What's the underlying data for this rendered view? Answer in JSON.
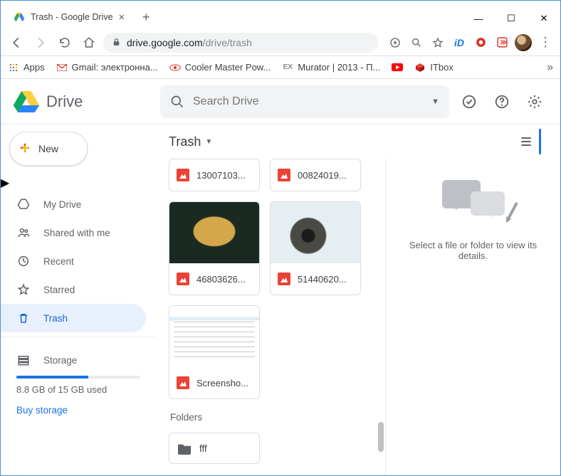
{
  "window": {
    "tab_title": "Trash - Google Drive"
  },
  "address_bar": {
    "host": "drive.google.com",
    "path": "/drive/trash",
    "full": "drive.google.com/drive/trash"
  },
  "bookmarks": {
    "apps": "Apps",
    "items": [
      "Gmail: электронна...",
      "Cooler Master Pow...",
      "Murator | 2013 - П...",
      "",
      "ITbox"
    ]
  },
  "drive": {
    "product": "Drive",
    "search_placeholder": "Search Drive",
    "new_button": "New",
    "nav": {
      "my_drive": "My Drive",
      "shared": "Shared with me",
      "recent": "Recent",
      "starred": "Starred",
      "trash": "Trash",
      "storage": "Storage"
    },
    "storage": {
      "used_text": "8.8 GB of 15 GB used",
      "buy": "Buy storage"
    },
    "breadcrumb": "Trash",
    "files_cut": [
      {
        "name": "13007103..."
      },
      {
        "name": "00824019..."
      }
    ],
    "files": [
      {
        "name": "46803626...",
        "thumb": "img1"
      },
      {
        "name": "51440620...",
        "thumb": "img2"
      },
      {
        "name": "Screensho...",
        "thumb": "img3"
      }
    ],
    "folders_label": "Folders",
    "folders": [
      {
        "name": "fff"
      }
    ],
    "details_empty": "Select a file or folder to view its details."
  }
}
